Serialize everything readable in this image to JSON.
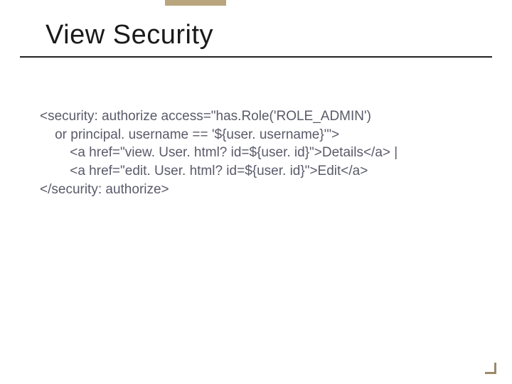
{
  "slide": {
    "title": "View Security",
    "code": {
      "line1": "<security: authorize access=\"has.Role('ROLE_ADMIN')",
      "line2": "    or principal. username == '${user. username}'\">",
      "line3": "        <a href=\"view. User. html? id=${user. id}\">Details</a> |",
      "line4": "        <a href=\"edit. User. html? id=${user. id}\">Edit</a>",
      "line5": "</security: authorize>"
    }
  }
}
